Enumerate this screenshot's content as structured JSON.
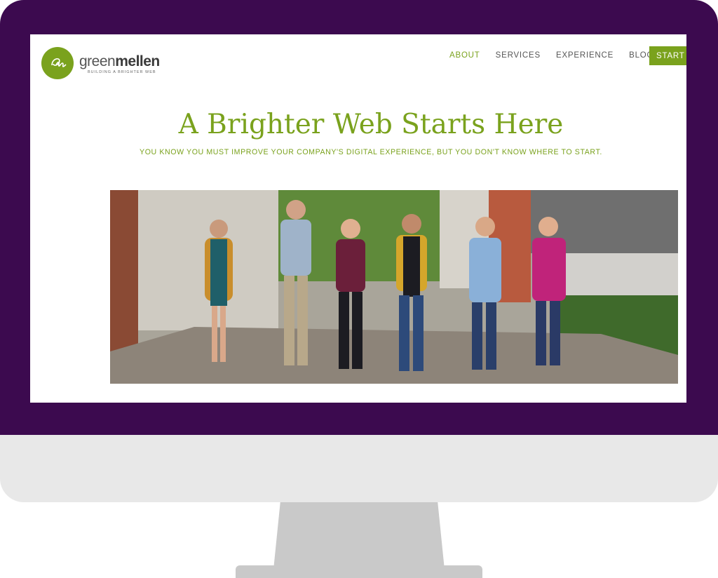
{
  "brand": {
    "name_light": "green",
    "name_bold": "mellen",
    "tagline": "BUILDING A BRIGHTER WEB",
    "logo_icon": "gm-monogram-icon"
  },
  "nav": {
    "items": [
      {
        "label": "ABOUT",
        "active": true
      },
      {
        "label": "SERVICES",
        "active": false
      },
      {
        "label": "EXPERIENCE",
        "active": false
      },
      {
        "label": "BLOG",
        "active": false
      }
    ],
    "cta_label": "START Y"
  },
  "hero": {
    "title": "A Brighter Web Starts Here",
    "subtitle": "YOU KNOW YOU MUST IMPROVE YOUR COMPANY'S DIGITAL EXPERIENCE, BUT YOU DON'T KNOW WHERE TO START."
  },
  "colors": {
    "accent": "#7aa21d",
    "bezel": "#3c0a4f",
    "stand": "#c9c9c9"
  }
}
